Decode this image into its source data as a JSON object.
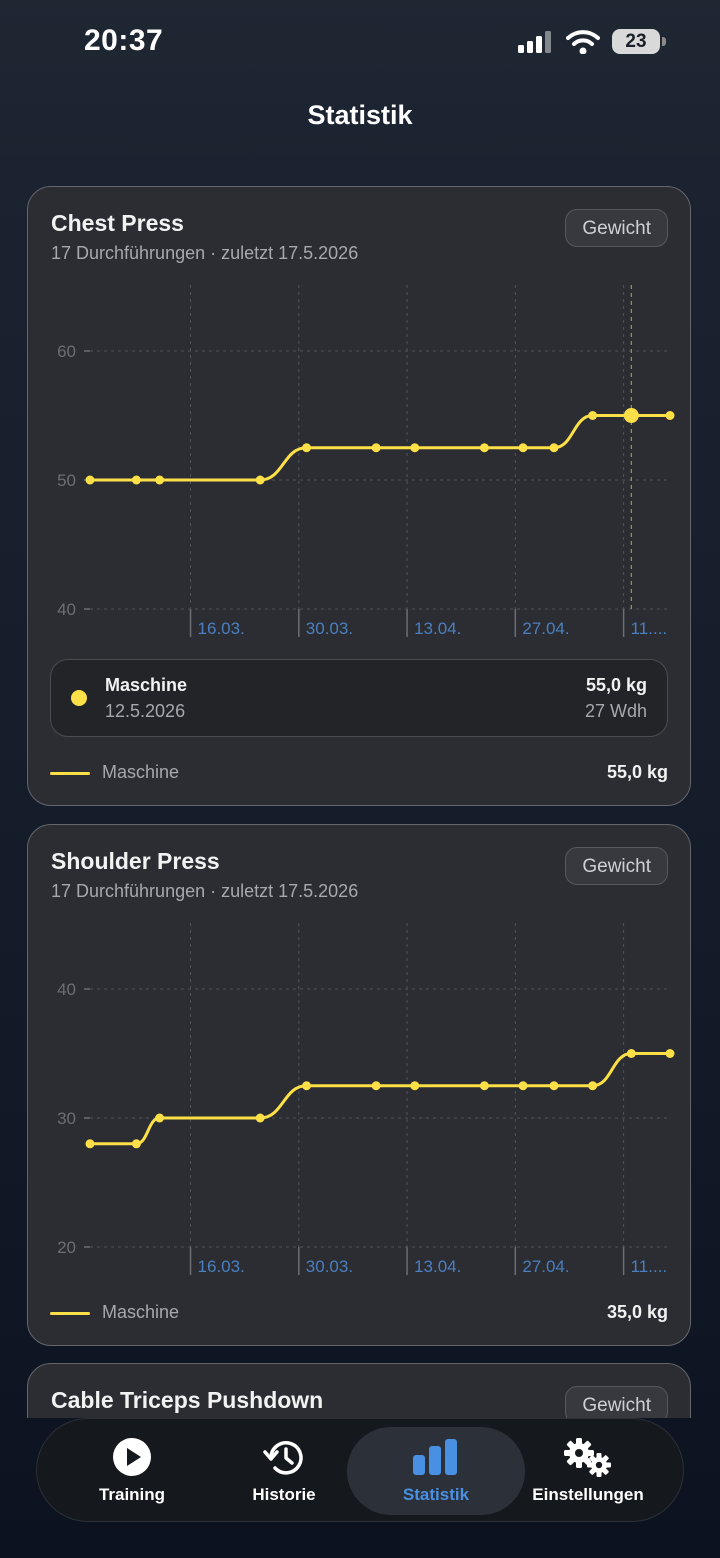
{
  "status_bar": {
    "time": "20:37",
    "battery": "23"
  },
  "nav": {
    "title": "Statistik"
  },
  "cards": [
    {
      "title": "Chest Press",
      "subtitle": "17 Durchführungen · zuletzt 17.5.2026",
      "metric_chip": "Gewicht",
      "selection": {
        "name": "Maschine",
        "date": "12.5.2026",
        "value": "55,0 kg",
        "reps": "27 Wdh"
      },
      "legend": {
        "label": "Maschine",
        "value": "55,0 kg"
      }
    },
    {
      "title": "Shoulder Press",
      "subtitle": "17 Durchführungen · zuletzt 17.5.2026",
      "metric_chip": "Gewicht",
      "legend": {
        "label": "Maschine",
        "value": "35,0 kg"
      }
    },
    {
      "title": "Cable Triceps Pushdown",
      "metric_chip": "Gewicht"
    }
  ],
  "chart_data": [
    {
      "type": "line",
      "title": "Chest Press",
      "x_tick_labels": [
        "16.03.",
        "30.03.",
        "13.04.",
        "27.04.",
        "11...."
      ],
      "y_ticks": [
        40,
        50,
        60
      ],
      "ylim": [
        40,
        60
      ],
      "series": [
        {
          "name": "Maschine",
          "x": [
            "2026-03-03",
            "2026-03-09",
            "2026-03-12",
            "2026-03-25",
            "2026-03-31",
            "2026-04-09",
            "2026-04-14",
            "2026-04-23",
            "2026-04-28",
            "2026-05-02",
            "2026-05-07",
            "2026-05-12",
            "2026-05-17"
          ],
          "values": [
            50,
            50,
            50,
            50,
            52.5,
            52.5,
            52.5,
            52.5,
            52.5,
            52.5,
            55,
            55,
            55
          ],
          "color": "#fde047",
          "highlighted_point": "2026-05-12"
        }
      ],
      "grid": true
    },
    {
      "type": "line",
      "title": "Shoulder Press",
      "x_tick_labels": [
        "16.03.",
        "30.03.",
        "13.04.",
        "27.04.",
        "11...."
      ],
      "y_ticks": [
        20,
        30,
        40
      ],
      "ylim": [
        20,
        40
      ],
      "series": [
        {
          "name": "Maschine",
          "x": [
            "2026-03-03",
            "2026-03-09",
            "2026-03-12",
            "2026-03-25",
            "2026-03-31",
            "2026-04-09",
            "2026-04-14",
            "2026-04-23",
            "2026-04-28",
            "2026-05-02",
            "2026-05-07",
            "2026-05-12",
            "2026-05-17"
          ],
          "values": [
            28,
            28,
            30,
            30,
            32.5,
            32.5,
            32.5,
            32.5,
            32.5,
            32.5,
            32.5,
            35,
            35
          ],
          "color": "#fde047"
        }
      ],
      "grid": true
    }
  ],
  "tabs": [
    {
      "label": "Training",
      "icon": "play-circle-icon"
    },
    {
      "label": "Historie",
      "icon": "history-clock-icon"
    },
    {
      "label": "Statistik",
      "icon": "bar-chart-icon",
      "active": true
    },
    {
      "label": "Einstellungen",
      "icon": "gears-icon"
    }
  ],
  "colors": {
    "accent": "#fde047",
    "active_tab": "#4a90e2",
    "axis_label": "#4a7fc0"
  }
}
